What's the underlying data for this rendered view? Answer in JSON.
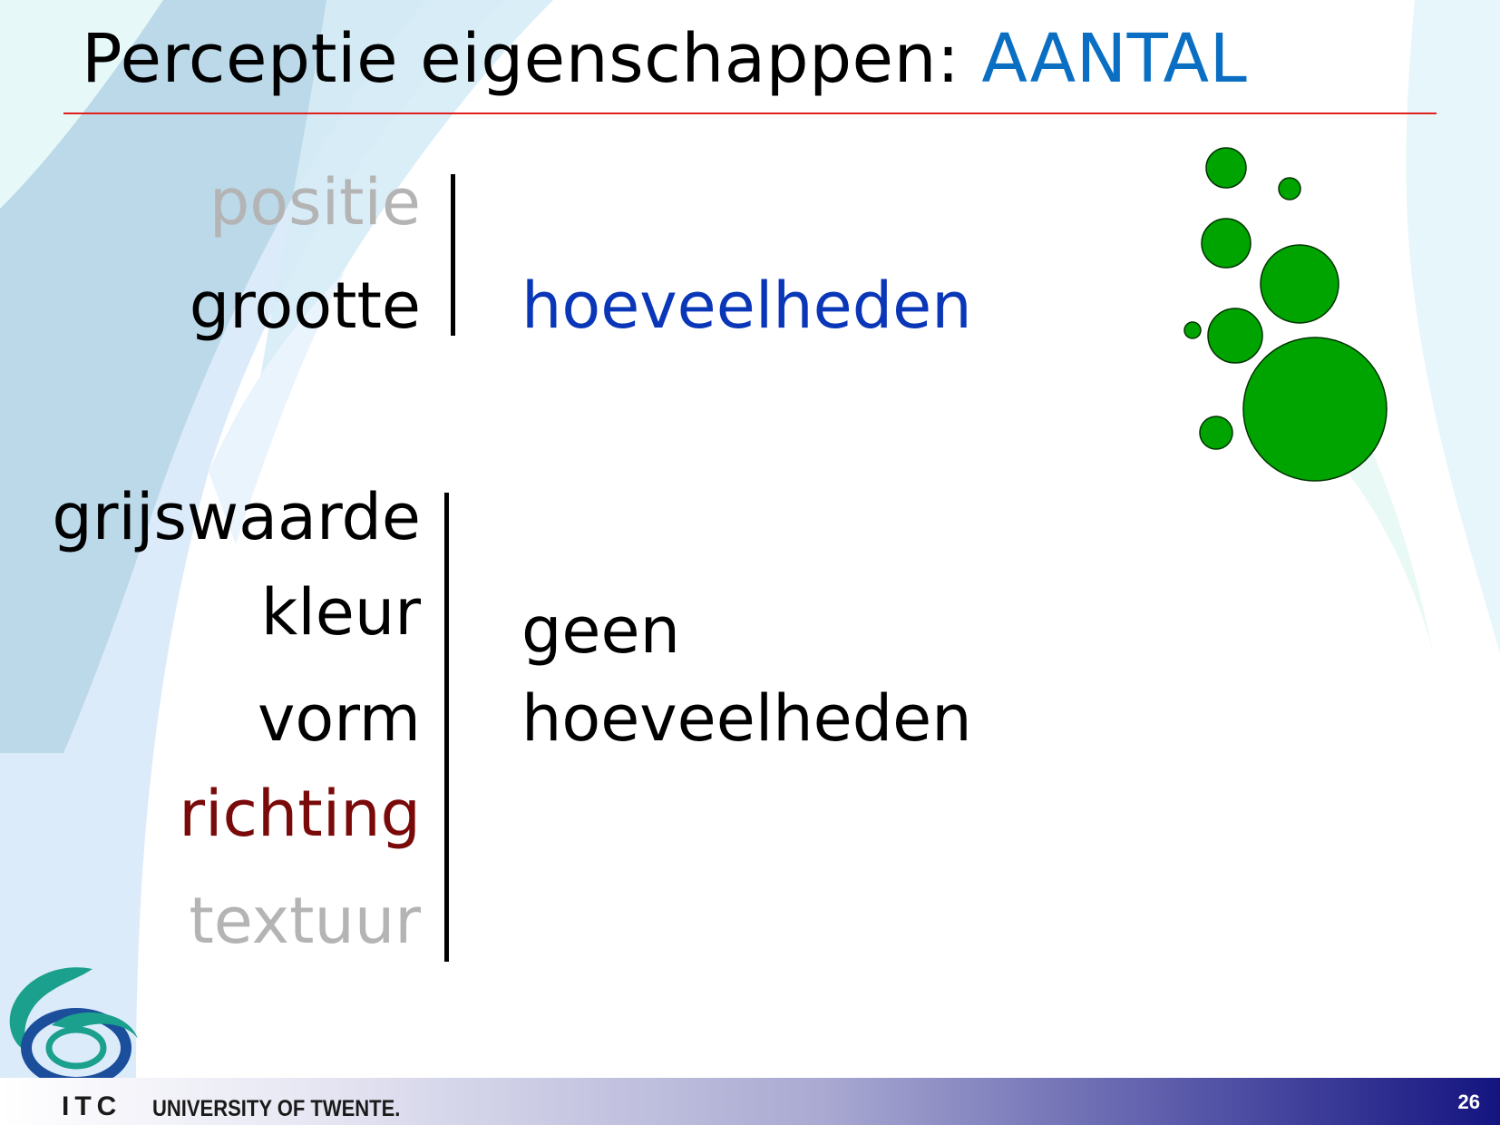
{
  "slide": {
    "title_main": "Perceptie eigenschappen: ",
    "title_accent": "AANTAL",
    "page_number": "26"
  },
  "group_one": {
    "labels": [
      "positie",
      "grootte"
    ],
    "value": "hoeveelheden"
  },
  "group_two": {
    "labels": [
      "grijswaarde",
      "kleur",
      "vorm",
      "richting",
      "textuur"
    ],
    "value_line1": "geen",
    "value_line2": "hoeveelheden"
  },
  "footer": {
    "itc": "ITC",
    "university": "UNIVERSITY OF TWENTE."
  },
  "colors": {
    "accent_blue": "#0a6fc2",
    "value_blue": "#0a36b8",
    "muted_gray": "#b4b4b4",
    "dark_red": "#7a0a0a",
    "circle_green": "#00a400"
  },
  "icons": {
    "logo": "itc-swirl-logo",
    "circles": "proportional-circles-illustration"
  }
}
